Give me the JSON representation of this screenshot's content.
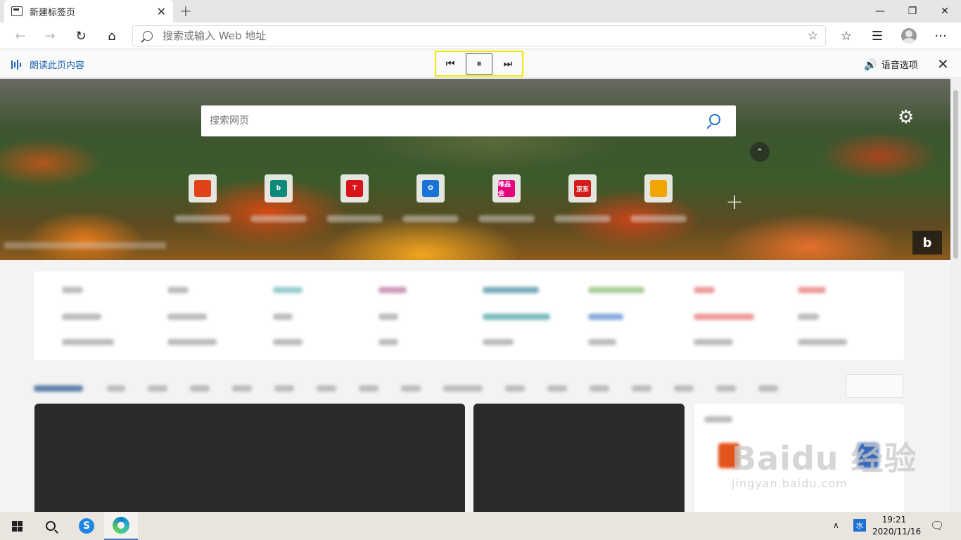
{
  "tab": {
    "title": "新建标签页",
    "close": "✕"
  },
  "newtab": "+",
  "window": {
    "minimize": "—",
    "restore": "❐",
    "close": "✕"
  },
  "nav": {
    "back": "←",
    "forward": "→",
    "refresh": "↻",
    "home": "⌂",
    "favorites": "☆",
    "collections": "☰",
    "menu": "···"
  },
  "address": {
    "placeholder": "搜索或输入 Web 地址",
    "star": "☆"
  },
  "readaloud": {
    "label": "朗读此页内容",
    "prev": "⏮",
    "pause": "⏸",
    "next": "⏭",
    "voice_options": "语音选项",
    "close": "✕"
  },
  "newtabpage": {
    "search_placeholder": "搜索网页",
    "settings": "⚙",
    "collapse": "⌃",
    "add_site": "+",
    "bing": "b",
    "tiles": [
      {
        "icon": "office-icon",
        "color": "#e0421a",
        "glyph": ""
      },
      {
        "icon": "bing-icon",
        "color": "#0c8a7a",
        "glyph": "b"
      },
      {
        "icon": "tmall-icon",
        "color": "#d8131b",
        "glyph": "T"
      },
      {
        "icon": "outlook-icon",
        "color": "#1a73d6",
        "glyph": "O"
      },
      {
        "icon": "vip-icon",
        "color": "#e6007e",
        "glyph": "唯品会"
      },
      {
        "icon": "jd-icon",
        "color": "#d51a1a",
        "glyph": "京东"
      },
      {
        "icon": "game-icon",
        "color": "#f2a400",
        "glyph": ""
      }
    ]
  },
  "watermark": {
    "main": "Baidu 经验",
    "sub": "jingyan.baidu.com"
  },
  "taskbar": {
    "sogou": "S",
    "tray_up": "∧",
    "ime": "水",
    "time": "19:21",
    "date": "2020/11/16",
    "notification": "🗨"
  }
}
